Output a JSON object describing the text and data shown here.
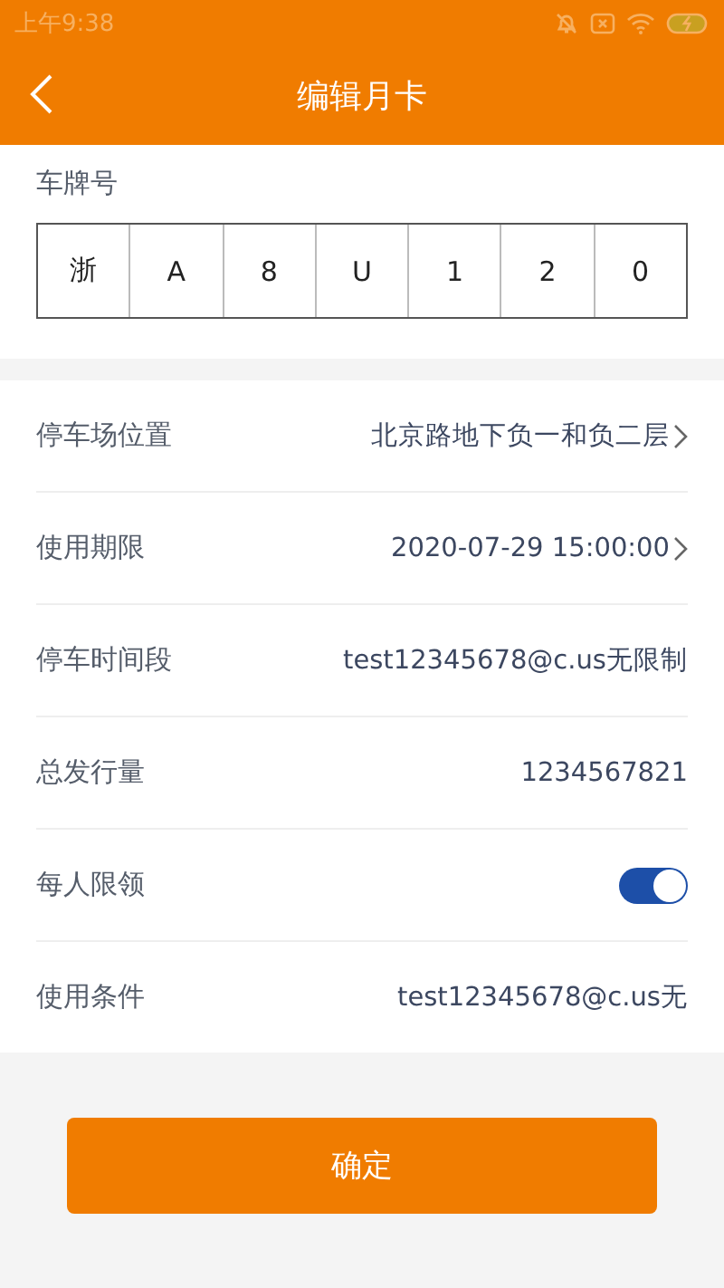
{
  "status_bar": {
    "time": "上午9:38"
  },
  "header": {
    "title": "编辑月卡"
  },
  "plate": {
    "label": "车牌号",
    "chars": [
      "浙",
      "A",
      "8",
      "U",
      "1",
      "2",
      "0"
    ]
  },
  "rows": [
    {
      "kind": "link",
      "label": "停车场位置",
      "value": "北京路地下负一和负二层"
    },
    {
      "kind": "link",
      "label": "使用期限",
      "value": "2020-07-29 15:00:00"
    },
    {
      "kind": "text",
      "label": "停车时间段",
      "value": "test12345678@c.us无限制"
    },
    {
      "kind": "text",
      "label": "总发行量",
      "value": "1234567821"
    },
    {
      "kind": "toggle",
      "label": "每人限领",
      "on": true
    },
    {
      "kind": "text",
      "label": "使用条件",
      "value": "test12345678@c.us无"
    }
  ],
  "confirm_button": "确定"
}
